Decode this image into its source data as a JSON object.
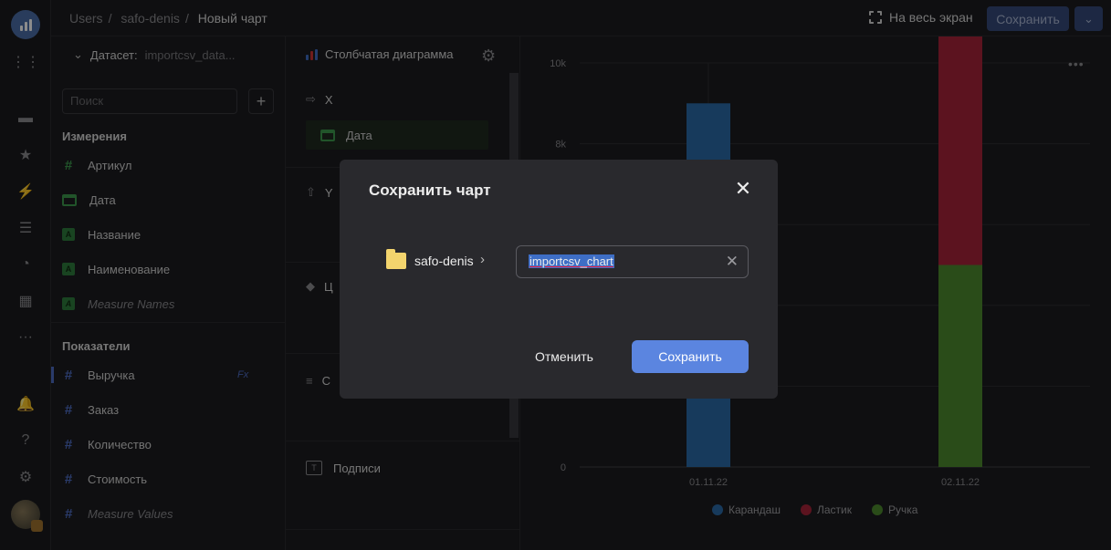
{
  "breadcrumbs": [
    "Users",
    "safo-denis",
    "Новый чарт"
  ],
  "header": {
    "fullscreen_label": "На весь экран",
    "save_label": "Сохранить"
  },
  "dataset": {
    "label": "Датасет:",
    "name": "importcsv_data...",
    "search_placeholder": "Поиск",
    "dimensions_title": "Измерения",
    "dimensions": [
      {
        "label": "Артикул",
        "icon": "hash-icon"
      },
      {
        "label": "Дата",
        "icon": "calendar-icon"
      },
      {
        "label": "Название",
        "icon": "text-icon"
      },
      {
        "label": "Наименование",
        "icon": "text-icon"
      },
      {
        "label": "Measure Names",
        "icon": "text-icon"
      }
    ],
    "measures_title": "Показатели",
    "measures": [
      {
        "label": "Выручка",
        "icon": "hash-icon",
        "formula": "Fx"
      },
      {
        "label": "Заказ",
        "icon": "hash-icon"
      },
      {
        "label": "Количество",
        "icon": "hash-icon"
      },
      {
        "label": "Стоимость",
        "icon": "hash-icon"
      },
      {
        "label": "Measure Values",
        "icon": "hash-icon"
      }
    ]
  },
  "visual": {
    "chart_type_label": "Столбчатая диаграмма",
    "x_label": "X",
    "x_field": "Дата",
    "y_label": "Y",
    "colors_label": "Ц",
    "sort_label": "С",
    "labels_label": "Подписи"
  },
  "chart_data": {
    "type": "bar",
    "stacked": true,
    "categories": [
      "01.11.22",
      "02.11.22"
    ],
    "series": [
      {
        "name": "Карандаш",
        "color": "#2b6aa8",
        "values": [
          9000,
          0
        ]
      },
      {
        "name": "Ластик",
        "color": "#a8243a",
        "values": [
          0,
          8000
        ]
      },
      {
        "name": "Ручка",
        "color": "#4e8a2e",
        "values": [
          0,
          5000
        ]
      }
    ],
    "ylim": [
      0,
      10000
    ],
    "y_ticks": [
      "0",
      "8k",
      "10k"
    ],
    "grid": true,
    "legend": "bottom"
  },
  "dialog": {
    "title": "Сохранить чарт",
    "folder": "safo-denis",
    "name_value": "importcsv_chart",
    "cancel_label": "Отменить",
    "save_label": "Сохранить"
  }
}
